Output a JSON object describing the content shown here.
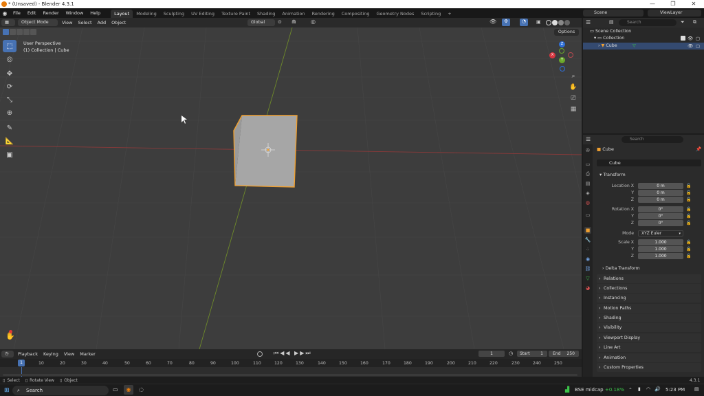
{
  "window": {
    "title": "* (Unsaved) - Blender 4.3.1",
    "minimize": "—",
    "maximize": "❐",
    "close": "✕"
  },
  "menu": [
    "File",
    "Edit",
    "Render",
    "Window",
    "Help"
  ],
  "workspaces": [
    "Layout",
    "Modeling",
    "Sculpting",
    "UV Editing",
    "Texture Paint",
    "Shading",
    "Animation",
    "Rendering",
    "Compositing",
    "Geometry Nodes",
    "Scripting"
  ],
  "workspace_add": "+",
  "scene": {
    "label": "Scene",
    "view_layer": "ViewLayer"
  },
  "viewport_header": {
    "mode": "Object Mode",
    "items": [
      "View",
      "Select",
      "Add",
      "Object"
    ],
    "transform": "Global",
    "options": "Options"
  },
  "viewport": {
    "overlay_line1": "User Perspective",
    "overlay_line2": "(1) Collection | Cube"
  },
  "gizmo": {
    "x": "X",
    "y": "Y",
    "z": "Z"
  },
  "timeline": {
    "menus": [
      "Playback",
      "Keying",
      "View",
      "Marker"
    ],
    "current_frame": "1",
    "start_label": "Start",
    "start": "1",
    "end_label": "End",
    "end": "250",
    "ticks": [
      "1",
      "10",
      "20",
      "30",
      "40",
      "50",
      "60",
      "70",
      "80",
      "90",
      "100",
      "110",
      "120",
      "130",
      "140",
      "150",
      "160",
      "170",
      "180",
      "190",
      "200",
      "210",
      "220",
      "230",
      "240",
      "250"
    ]
  },
  "statusbar": {
    "select": "Select",
    "rotate": "Rotate View",
    "object": "Object",
    "version": "4.3.1"
  },
  "outliner": {
    "search_placeholder": "Search",
    "scene_collection": "Scene Collection",
    "collection": "Collection",
    "cube": "Cube"
  },
  "properties": {
    "search_placeholder": "Search",
    "object_name": "Cube",
    "data_name": "Cube",
    "transform": "Transform",
    "location_x_label": "Location X",
    "location_y_label": "Y",
    "location_z_label": "Z",
    "location_x": "0 m",
    "location_y": "0 m",
    "location_z": "0 m",
    "rotation_x_label": "Rotation X",
    "rotation_y_label": "Y",
    "rotation_z_label": "Z",
    "rotation_x": "0°",
    "rotation_y": "0°",
    "rotation_z": "0°",
    "mode_label": "Mode",
    "mode": "XYZ Euler",
    "scale_x_label": "Scale X",
    "scale_y_label": "Y",
    "scale_z_label": "Z",
    "scale_x": "1.000",
    "scale_y": "1.000",
    "scale_z": "1.000",
    "delta_transform": "Delta Transform",
    "panels": [
      "Relations",
      "Collections",
      "Instancing",
      "Motion Paths",
      "Shading",
      "Visibility",
      "Viewport Display",
      "Line Art",
      "Animation",
      "Custom Properties"
    ]
  },
  "taskbar": {
    "search": "Search",
    "stock_name": "BSE midcap",
    "stock_change": "+0.18%",
    "time": "5:23 PM"
  },
  "colors": {
    "accent": "#4772b3",
    "selection": "#f0a030",
    "stock_up": "#3cc34a"
  }
}
